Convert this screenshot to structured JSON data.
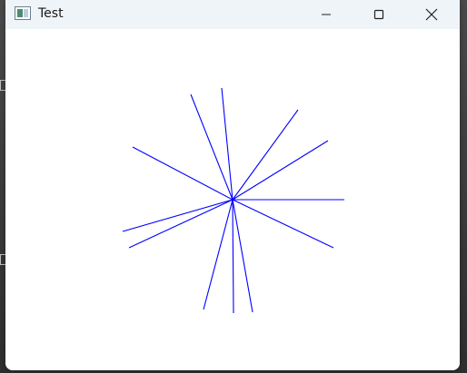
{
  "window": {
    "title": "Test"
  },
  "titlebar": {
    "buttons": {
      "minimize": "minimize-icon",
      "maximize": "maximize-icon",
      "close": "close-icon"
    }
  },
  "canvas": {
    "line_color": "#0000ff",
    "background": "#ffffff"
  }
}
